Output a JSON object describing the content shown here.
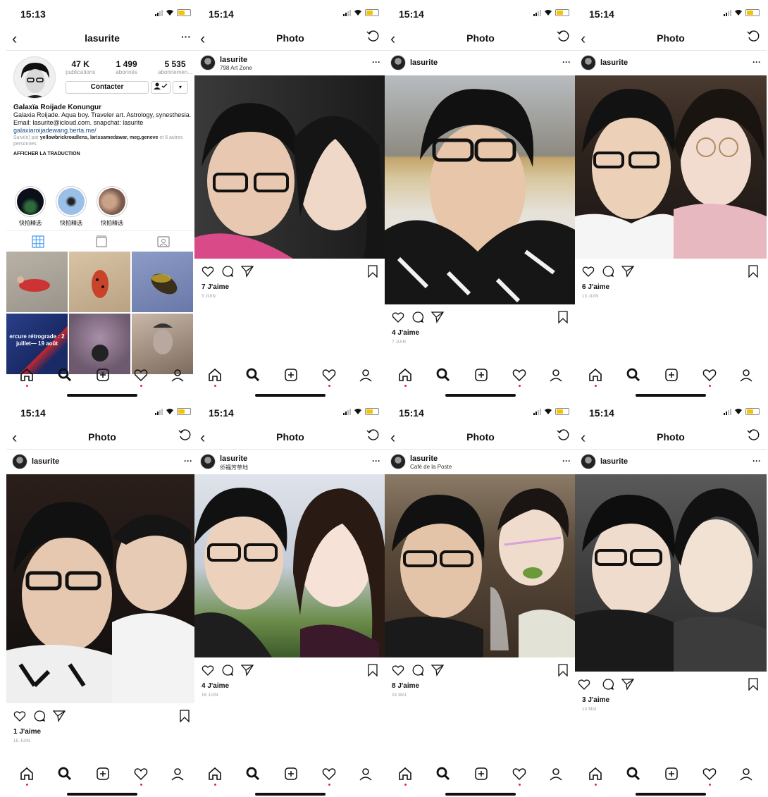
{
  "panels": [
    {
      "time": "15:13",
      "nav_title": "lasurite",
      "profile": {
        "stats": [
          {
            "value": "47 K",
            "label": "publications"
          },
          {
            "value": "1 499",
            "label": "abonnés"
          },
          {
            "value": "5 535",
            "label": "abonnemen..."
          }
        ],
        "contact_label": "Contacter",
        "full_name": "Galaxïa Roijade Konungur",
        "bio": "Galaxia Roijade. Aqua boy. Traveler art. Astrology, synesthesia. Email: lasurite@icloud.com. snapchat: lasurite",
        "link": "galaxiaroijadewang.berta.me/",
        "followed_by_prefix": "Suivi(e) par",
        "followed_by_names": "yellowbrickroadlens, larissamedawar, meg.geneve",
        "followed_by_suffix": "et 6 autres personnes",
        "translate": "AFFICHER LA TRADUCTION",
        "highlights": [
          "快拍精选",
          "快拍精选",
          "快拍精选"
        ],
        "thumb_caption": "ercure rétrograde : 2 juillet— 19 août"
      }
    },
    {
      "time": "15:14",
      "nav_title": "Photo",
      "user": "lasurite",
      "location": "798 Art Zone",
      "likes": "7 J'aime",
      "date": "3 JUIN"
    },
    {
      "time": "15:14",
      "nav_title": "Photo",
      "user": "lasurite",
      "location": "",
      "likes": "4 J'aime",
      "date": "7 JUIN"
    },
    {
      "time": "15:14",
      "nav_title": "Photo",
      "user": "lasurite",
      "location": "",
      "likes": "6 J'aime",
      "date": "13 JUIN"
    },
    {
      "time": "15:14",
      "nav_title": "Photo",
      "user": "lasurite",
      "location": "",
      "likes": "1 J'aime",
      "date": "15 JUIN"
    },
    {
      "time": "15:14",
      "nav_title": "Photo",
      "user": "lasurite",
      "location": "侨福芳草地",
      "likes": "4 J'aime",
      "date": "16 JUIN"
    },
    {
      "time": "15:14",
      "nav_title": "Photo",
      "user": "lasurite",
      "location": "Café de la Poste",
      "likes": "8 J'aime",
      "date": "24 MAI"
    },
    {
      "time": "15:14",
      "nav_title": "Photo",
      "user": "lasurite",
      "location": "",
      "likes": "3 J'aime",
      "date": "13 MAI"
    }
  ],
  "icons": {
    "back": "chevron-left-icon",
    "more": "more-dots-icon",
    "refresh": "refresh-icon",
    "like": "heart-icon",
    "comment": "comment-icon",
    "share": "send-icon",
    "save": "bookmark-icon",
    "tabs": [
      "home-icon",
      "search-icon",
      "add-icon",
      "activity-heart-icon",
      "profile-icon"
    ]
  },
  "colors": {
    "link": "#1a4d8c",
    "notification_dot": "#e0245e",
    "battery": "#f5c400"
  }
}
